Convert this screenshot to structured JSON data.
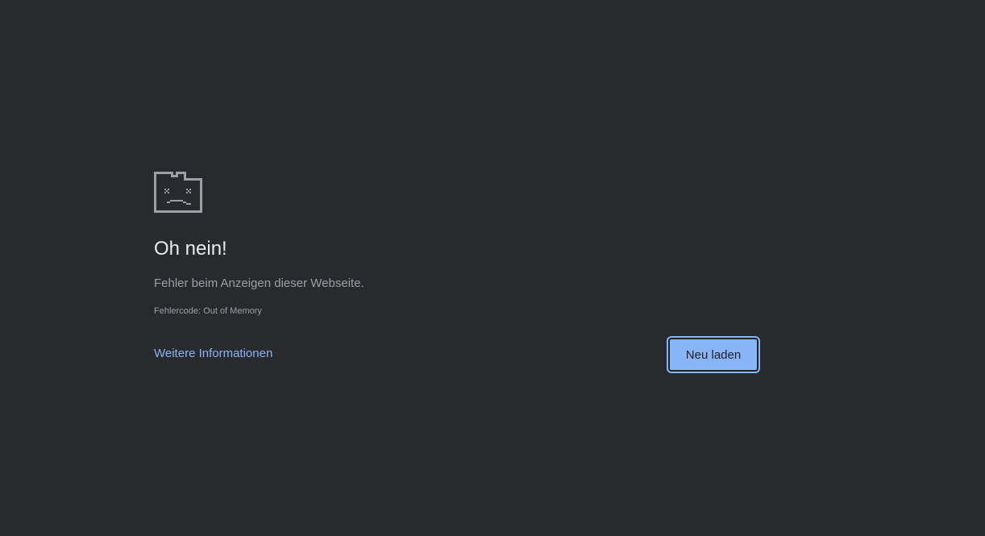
{
  "page": {
    "background": "#292a2d",
    "icon": "sad-tab-icon"
  },
  "error": {
    "title": "Oh nein!",
    "message": "Fehler beim Anzeigen dieser Webseite.",
    "code": "Fehlercode: Out of Memory"
  },
  "actions": {
    "learn_more_label": "Weitere Informationen",
    "reload_label": "Neu laden"
  },
  "colors": {
    "title": "#e8eaed",
    "text_secondary": "#9aa0a6",
    "link": "#8ab4f8",
    "button_bg": "#8ab4f8",
    "icon": "#9aa0a6"
  }
}
